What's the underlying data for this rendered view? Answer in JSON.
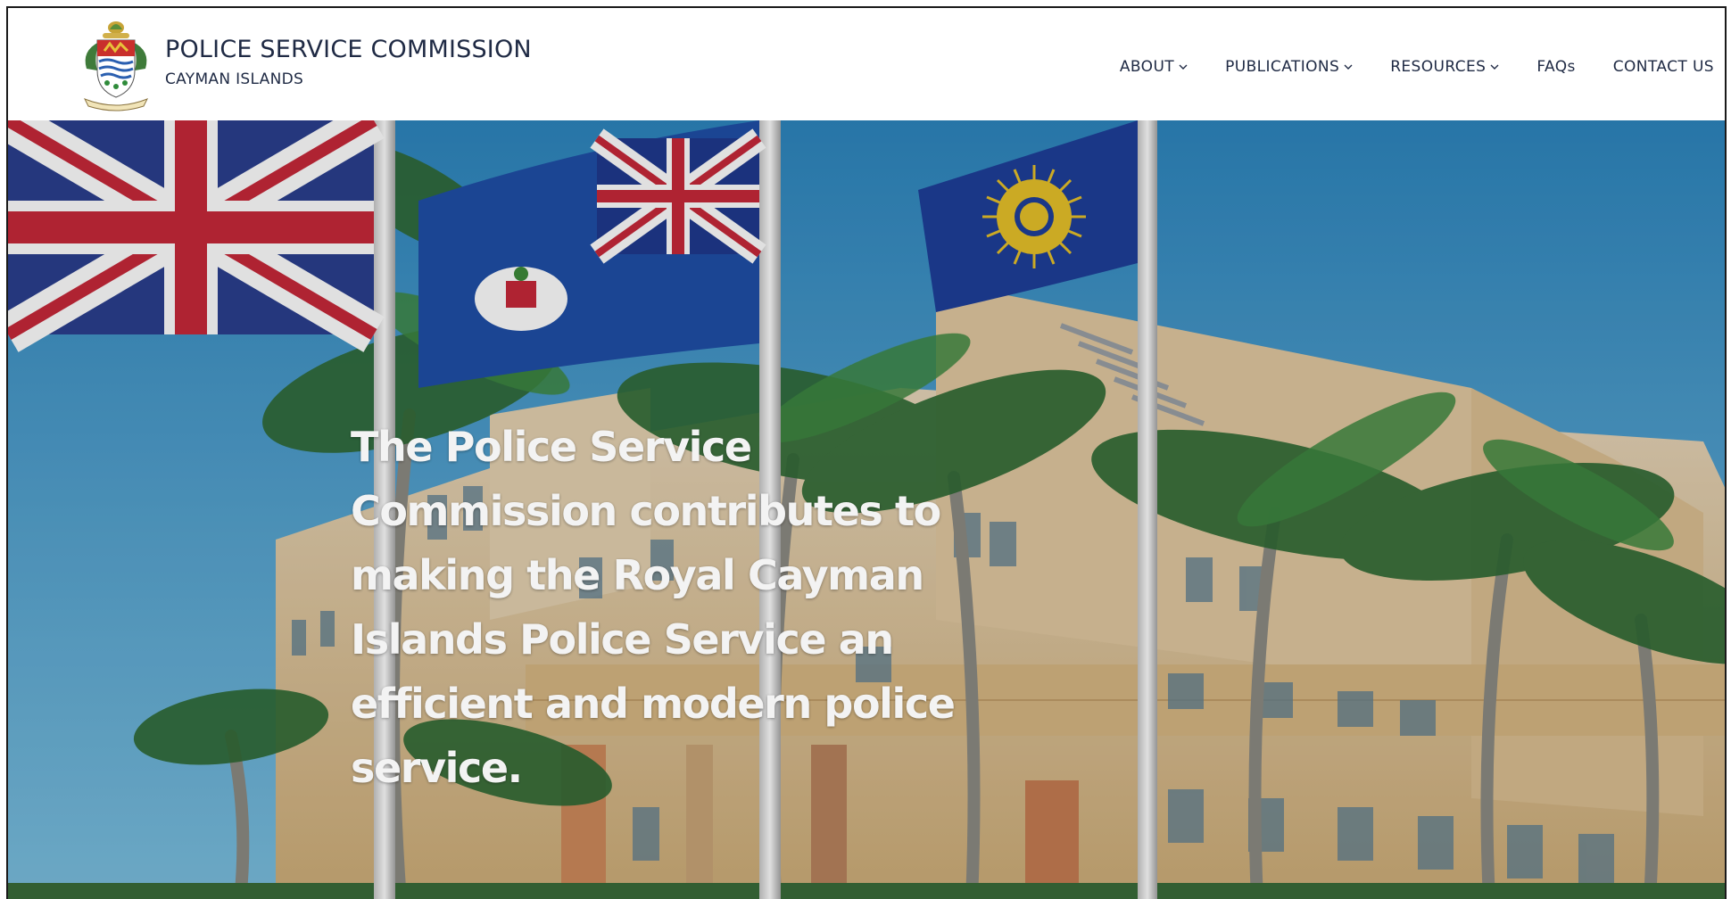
{
  "header": {
    "title": "POLICE SERVICE COMMISSION",
    "subtitle": "CAYMAN ISLANDS",
    "logo_icon": "cayman-islands-coat-of-arms"
  },
  "nav": {
    "items": [
      {
        "label": "ABOUT",
        "has_dropdown": true
      },
      {
        "label": "PUBLICATIONS",
        "has_dropdown": true
      },
      {
        "label": "RESOURCES",
        "has_dropdown": true
      },
      {
        "label": "FAQs",
        "has_dropdown": false
      },
      {
        "label": "CONTACT US",
        "has_dropdown": false
      }
    ]
  },
  "hero": {
    "heading": "The Police Service Commission contributes to making the Royal Cayman Islands Police Service an efficient and modern police service."
  },
  "colors": {
    "navy_text": "#1f2a44",
    "sky": "#3f9ccc",
    "building": "#d9c19a"
  }
}
